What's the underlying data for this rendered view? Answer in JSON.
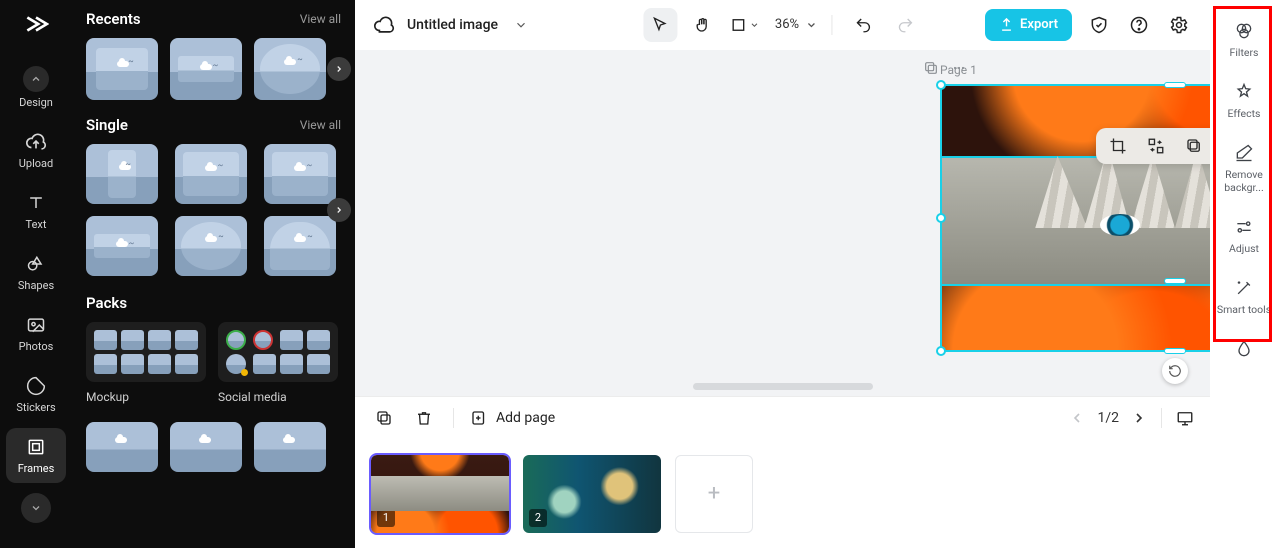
{
  "rail": {
    "items": [
      {
        "label": "Design"
      },
      {
        "label": "Upload"
      },
      {
        "label": "Text"
      },
      {
        "label": "Shapes"
      },
      {
        "label": "Photos"
      },
      {
        "label": "Stickers"
      },
      {
        "label": "Frames"
      }
    ]
  },
  "panel": {
    "recents": {
      "title": "Recents",
      "view_all": "View all"
    },
    "single": {
      "title": "Single",
      "view_all": "View all"
    },
    "packs": {
      "title": "Packs",
      "labels": [
        "Mockup",
        "Social media"
      ]
    }
  },
  "topbar": {
    "title": "Untitled image",
    "zoom": "36%",
    "export": "Export"
  },
  "canvas": {
    "page_label": "Page 1"
  },
  "pagesbar": {
    "add": "Add page",
    "counter": "1/2",
    "thumbs": [
      "1",
      "2"
    ]
  },
  "rightbar": {
    "items": [
      "Filters",
      "Effects",
      "Remove backgr...",
      "Adjust",
      "Smart tools"
    ]
  }
}
